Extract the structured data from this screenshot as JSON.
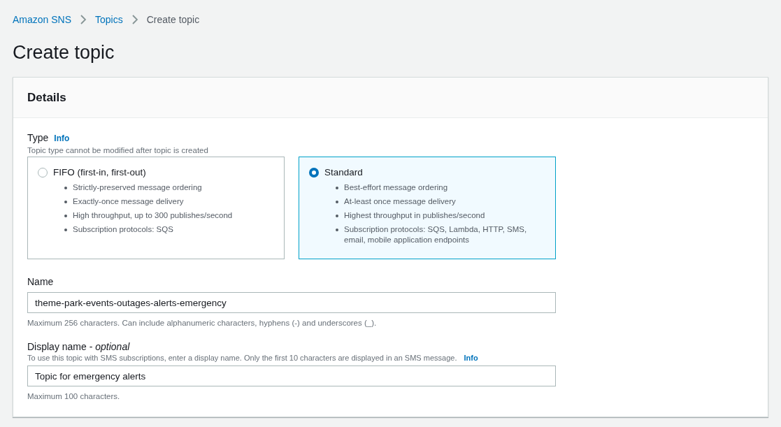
{
  "breadcrumbs": [
    {
      "label": "Amazon SNS",
      "current": false
    },
    {
      "label": "Topics",
      "current": false
    },
    {
      "label": "Create topic",
      "current": true
    }
  ],
  "title": "Create topic",
  "panel": {
    "title": "Details",
    "type_field": {
      "label": "Type",
      "info": "Info",
      "description": "Topic type cannot be modified after topic is created",
      "options": [
        {
          "label": "FIFO (first-in, first-out)",
          "selected": false,
          "bullets": [
            "Strictly-preserved message ordering",
            "Exactly-once message delivery",
            "High throughput, up to 300 publishes/second",
            "Subscription protocols: SQS"
          ]
        },
        {
          "label": "Standard",
          "selected": true,
          "bullets": [
            "Best-effort message ordering",
            "At-least once message delivery",
            "Highest throughput in publishes/second",
            "Subscription protocols: SQS, Lambda, HTTP, SMS, email, mobile application endpoints"
          ]
        }
      ]
    },
    "name_field": {
      "label": "Name",
      "value": "theme-park-events-outages-alerts-emergency",
      "hint": "Maximum 256 characters. Can include alphanumeric characters, hyphens (-) and underscores (_)."
    },
    "display_name_field": {
      "label": "Display name - *optional*",
      "description": "To use this topic with SMS subscriptions, enter a display name. Only the first 10 characters are displayed in an SMS message.",
      "info": "Info",
      "value": "Topic for emergency alerts",
      "hint": "Maximum 100 characters."
    }
  }
}
